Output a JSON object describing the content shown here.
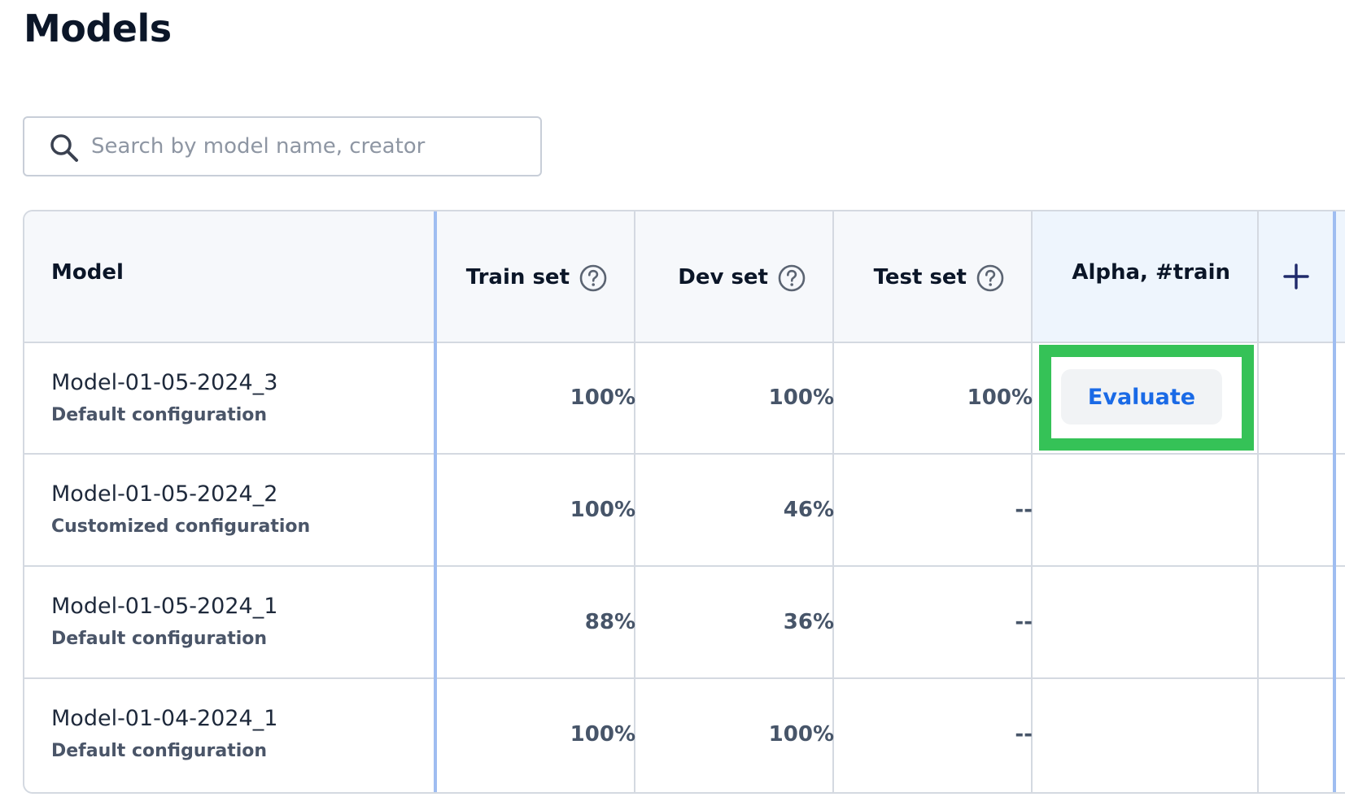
{
  "page": {
    "title": "Models"
  },
  "search": {
    "placeholder": "Search by model name, creator",
    "value": ""
  },
  "table": {
    "columns": {
      "model": "Model",
      "train": "Train set",
      "dev": "Dev set",
      "test": "Test set",
      "alpha": "Alpha, #train"
    },
    "add_column_icon": "plus-icon",
    "help_icon": "question-circle-icon",
    "rows": [
      {
        "name": "Model-01-05-2024_3",
        "config": "Default configuration",
        "train": "100%",
        "dev": "100%",
        "test": "100%",
        "alpha_action": "Evaluate"
      },
      {
        "name": "Model-01-05-2024_2",
        "config": "Customized configuration",
        "train": "100%",
        "dev": "46%",
        "test": "--"
      },
      {
        "name": "Model-01-05-2024_1",
        "config": "Default configuration",
        "train": "88%",
        "dev": "36%",
        "test": "--"
      },
      {
        "name": "Model-01-04-2024_1",
        "config": "Default configuration",
        "train": "100%",
        "dev": "100%",
        "test": "--"
      }
    ]
  },
  "colors": {
    "highlight": "#35c257",
    "accent_blue": "#1a6ae6",
    "column_divider_blue": "#9fbdf1"
  }
}
